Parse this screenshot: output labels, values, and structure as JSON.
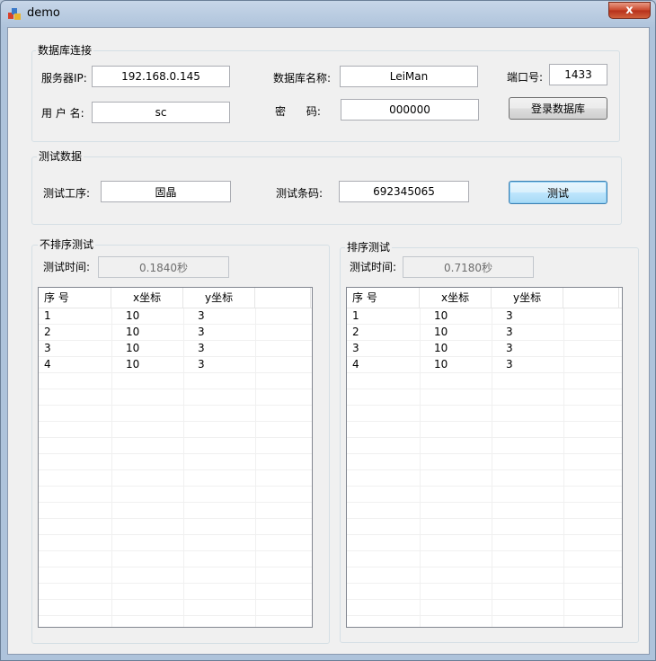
{
  "window": {
    "title": "demo",
    "close_glyph": "x",
    "icon": "app-icon"
  },
  "db_group": {
    "label": "数据库连接",
    "server_ip_label": "服务器IP:",
    "server_ip_value": "192.168.0.145",
    "db_name_label": "数据库名称:",
    "db_name_value": "LeiMan",
    "port_label": "端口号:",
    "port_value": "1433",
    "username_label": "用 户 名:",
    "username_value": "sc",
    "password_label": "密      码:",
    "password_value": "000000",
    "login_button": "登录数据库"
  },
  "test_group": {
    "label": "测试数据",
    "process_label": "测试工序:",
    "process_value": "固晶",
    "barcode_label": "测试条码:",
    "barcode_value": "692345065",
    "test_button": "测试"
  },
  "unsorted": {
    "label": "不排序测试",
    "time_label": "测试时间:",
    "time_value": "0.1840秒",
    "columns": [
      "序 号",
      "x坐标",
      "y坐标"
    ],
    "rows": [
      [
        "1",
        "10",
        "3"
      ],
      [
        "2",
        "10",
        "3"
      ],
      [
        "3",
        "10",
        "3"
      ],
      [
        "4",
        "10",
        "3"
      ]
    ]
  },
  "sorted": {
    "label": "排序测试",
    "time_label": "测试时间:",
    "time_value": "0.7180秒",
    "columns": [
      "序 号",
      "x坐标",
      "y坐标"
    ],
    "rows": [
      [
        "1",
        "10",
        "3"
      ],
      [
        "2",
        "10",
        "3"
      ],
      [
        "3",
        "10",
        "3"
      ],
      [
        "4",
        "10",
        "3"
      ]
    ]
  }
}
